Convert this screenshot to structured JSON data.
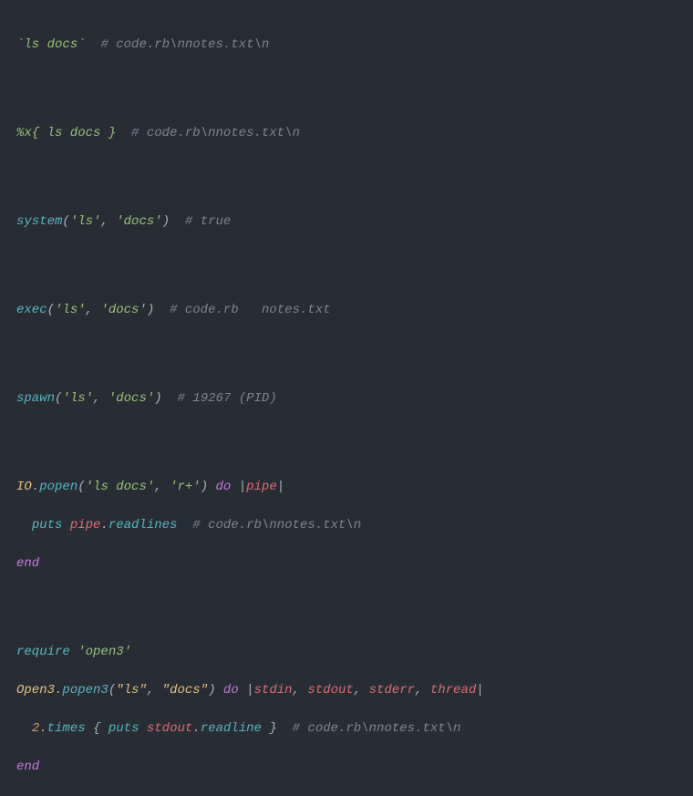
{
  "code": {
    "l1": {
      "backtick_open": "`",
      "backtick_cmd": "ls docs",
      "backtick_close": "`",
      "sp": "  ",
      "comment": "# code.rb\\nnotes.txt\\n"
    },
    "l2": {
      "pfx": "%x{ ",
      "cmd": "ls docs",
      "sfx": " }",
      "sp": "  ",
      "comment": "# code.rb\\nnotes.txt\\n"
    },
    "l3": {
      "fn": "system",
      "open": "(",
      "a1": "'ls'",
      "comma": ", ",
      "a2": "'docs'",
      "close": ")",
      "sp": "  ",
      "comment": "# true"
    },
    "l4": {
      "fn": "exec",
      "open": "(",
      "a1": "'ls'",
      "comma": ", ",
      "a2": "'docs'",
      "close": ")",
      "sp": "  ",
      "comment": "# code.rb   notes.txt"
    },
    "l5": {
      "fn": "spawn",
      "open": "(",
      "a1": "'ls'",
      "comma": ", ",
      "a2": "'docs'",
      "close": ")",
      "sp": "  ",
      "comment": "# 19267 (PID)"
    },
    "l6a": {
      "cls": "IO",
      "dot": ".",
      "fn": "popen",
      "open": "(",
      "a1": "'ls docs'",
      "comma": ", ",
      "a2": "'r+'",
      "close": ") ",
      "kw": "do",
      "pipe": " |",
      "param": "pipe",
      "pipe2": "|"
    },
    "l6b": {
      "indent": "  ",
      "fn": "puts",
      "sp": " ",
      "obj": "pipe",
      "dot": ".",
      "meth": "readlines",
      "sp2": "  ",
      "comment": "# code.rb\\nnotes.txt\\n"
    },
    "l6c": {
      "kw": "end"
    },
    "l7a": {
      "fn": "require",
      "sp": " ",
      "a1": "'open3'"
    },
    "l7b": {
      "cls": "Open3",
      "dot": ".",
      "fn": "popen3",
      "open": "(",
      "a1": "\"ls\"",
      "comma": ", ",
      "a2": "\"docs\"",
      "close": ") ",
      "kw": "do",
      "pipe": " |",
      "p1": "stdin",
      "c1": ", ",
      "p2": "stdout",
      "c2": ", ",
      "p3": "stderr",
      "c3": ", ",
      "p4": "thread",
      "pipe2": "|"
    },
    "l7c": {
      "indent": "  ",
      "num": "2",
      "dot": ".",
      "meth": "times",
      "sp": " { ",
      "fn": "puts",
      "sp2": " ",
      "obj": "stdout",
      "dot2": ".",
      "meth2": "readline",
      "close": " }",
      "sp3": "  ",
      "comment": "# code.rb\\nnotes.txt\\n"
    },
    "l7d": {
      "kw": "end"
    }
  }
}
